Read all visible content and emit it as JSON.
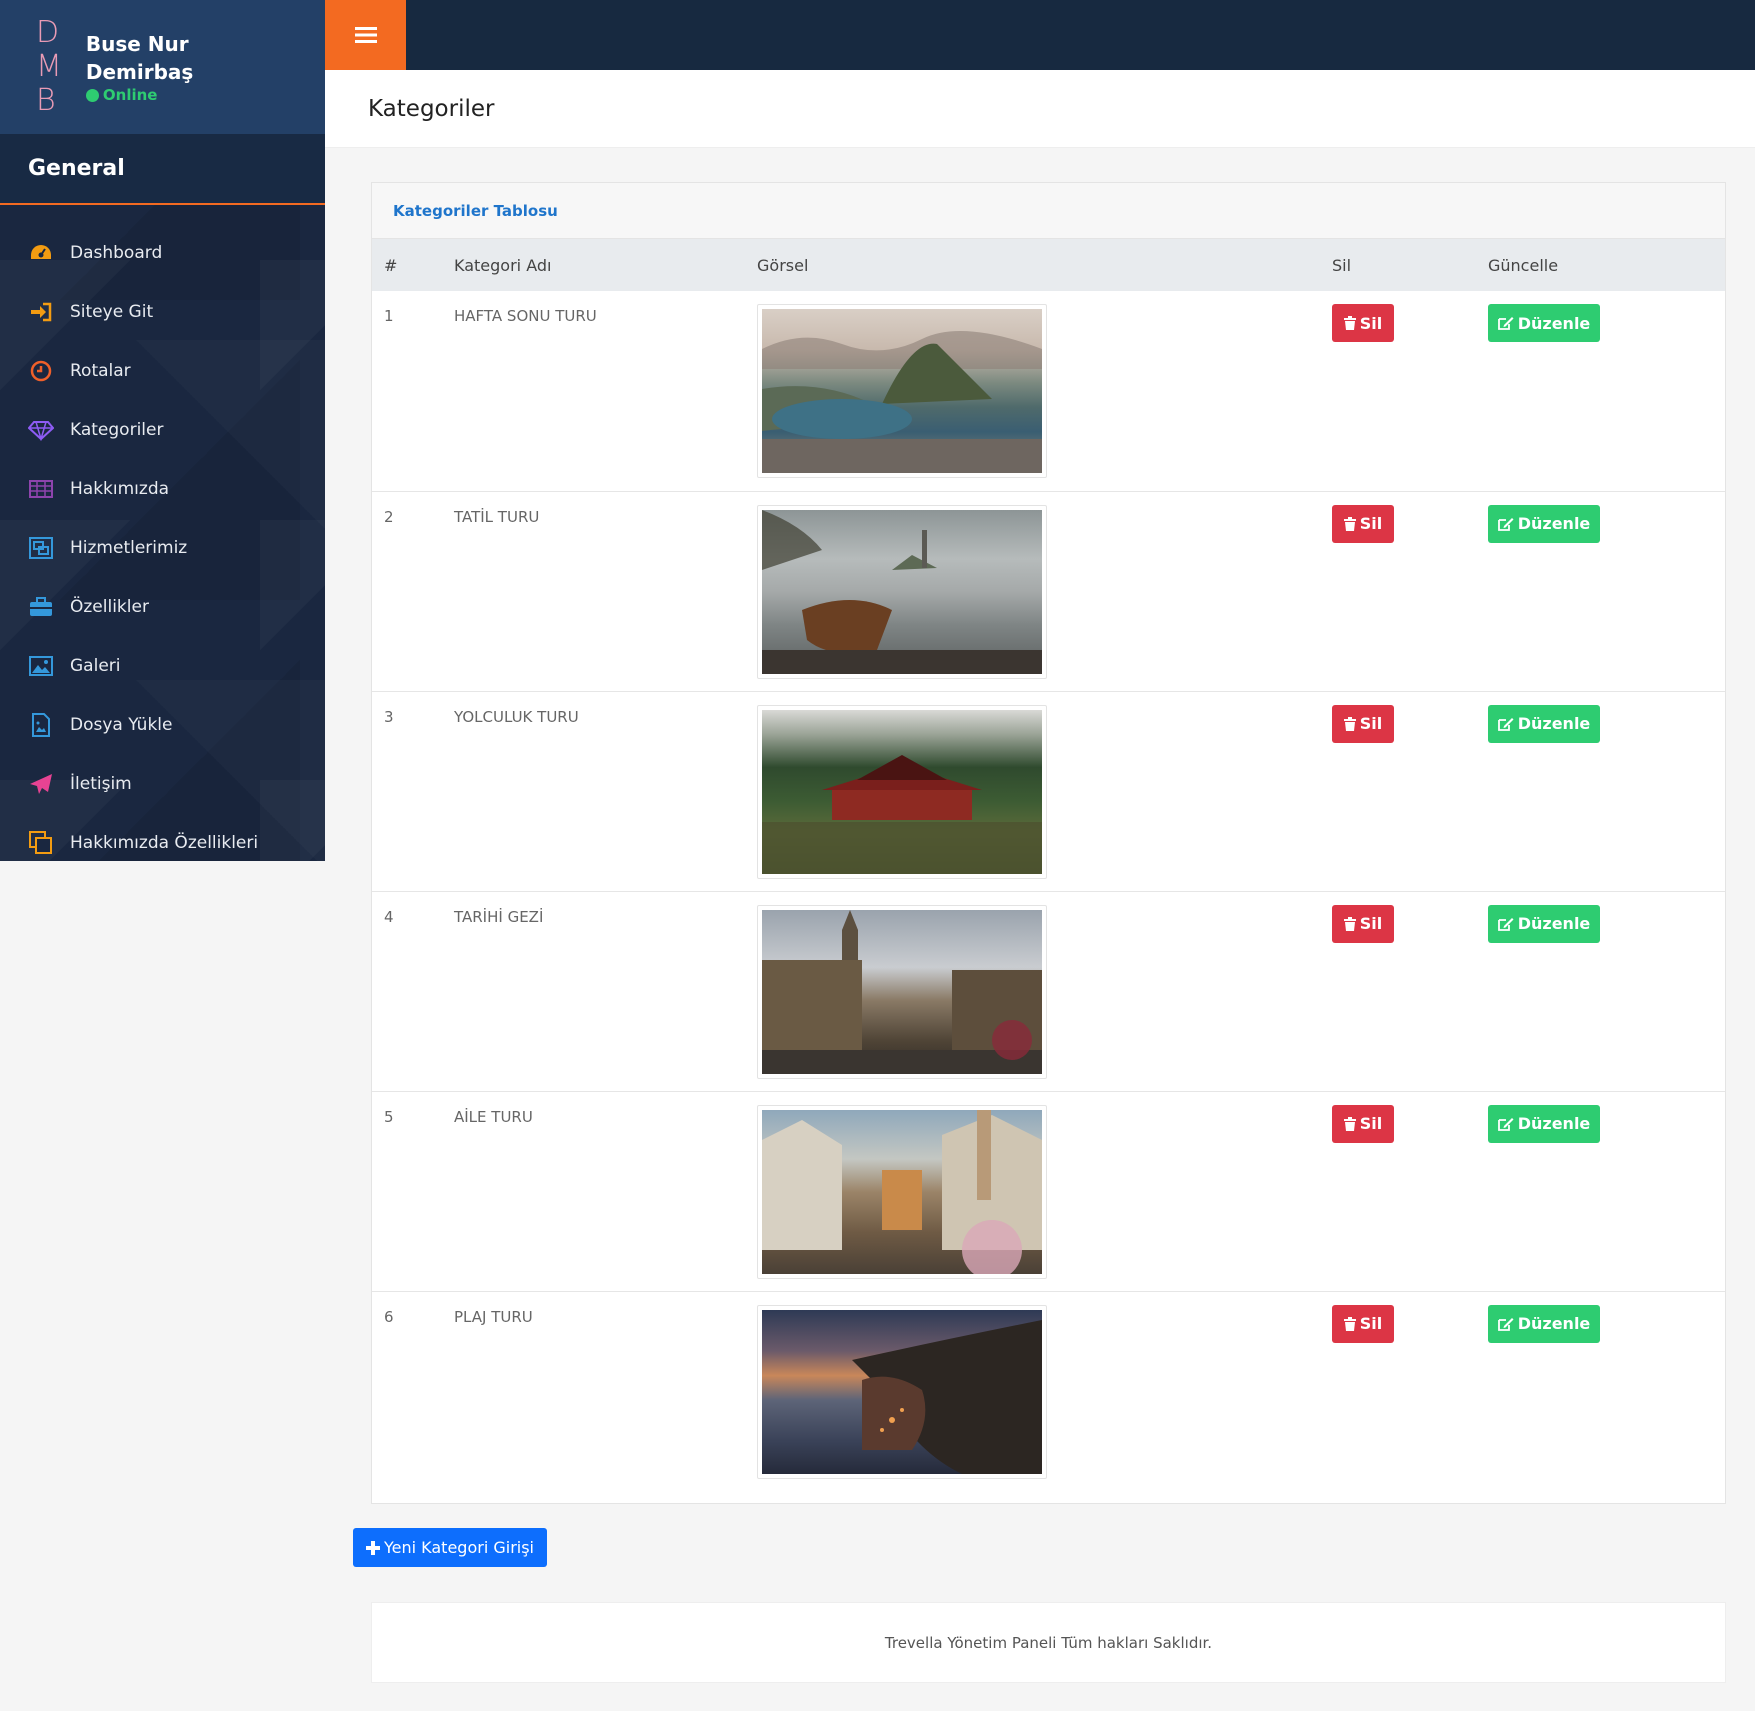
{
  "brand": {
    "letters": [
      "D",
      "M",
      "B"
    ],
    "user_name": "Buse Nur Demirbaş",
    "status": "Online"
  },
  "sidebar": {
    "section_title": "General",
    "items": [
      {
        "label": "Dashboard",
        "icon": "dashboard-icon",
        "color": "#f39c12"
      },
      {
        "label": "Siteye Git",
        "icon": "sign-in-icon",
        "color": "#f39c12"
      },
      {
        "label": "Rotalar",
        "icon": "clock-icon",
        "color": "#f0602a"
      },
      {
        "label": "Kategoriler",
        "icon": "diamond-icon",
        "color": "#8e5cf5"
      },
      {
        "label": "Hakkımızda",
        "icon": "table-icon",
        "color": "#8e44ad"
      },
      {
        "label": "Hizmetlerimiz",
        "icon": "object-group-icon",
        "color": "#3498db"
      },
      {
        "label": "Özellikler",
        "icon": "briefcase-icon",
        "color": "#3498db"
      },
      {
        "label": "Galeri",
        "icon": "image-icon",
        "color": "#3498db"
      },
      {
        "label": "Dosya Yükle",
        "icon": "file-image-icon",
        "color": "#3498db"
      },
      {
        "label": "İletişim",
        "icon": "paper-plane-icon",
        "color": "#e84393"
      },
      {
        "label": "Hakkımızda Özellikleri",
        "icon": "clone-icon",
        "color": "#f39c12"
      }
    ]
  },
  "header": {
    "page_title": "Kategoriler"
  },
  "card": {
    "title": "Kategoriler Tablosu",
    "columns": [
      "#",
      "Kategori Adı",
      "Görsel",
      "Sil",
      "Güncelle"
    ],
    "rows": [
      {
        "num": "1",
        "name": "HAFTA SONU TURU",
        "delete_label": "Sil",
        "edit_label": "Düzenle"
      },
      {
        "num": "2",
        "name": "TATİL TURU",
        "delete_label": "Sil",
        "edit_label": "Düzenle"
      },
      {
        "num": "3",
        "name": "YOLCULUK TURU",
        "delete_label": "Sil",
        "edit_label": "Düzenle"
      },
      {
        "num": "4",
        "name": "TARİHİ GEZİ",
        "delete_label": "Sil",
        "edit_label": "Düzenle"
      },
      {
        "num": "5",
        "name": "AİLE TURU",
        "delete_label": "Sil",
        "edit_label": "Düzenle"
      },
      {
        "num": "6",
        "name": "PLAJ TURU",
        "delete_label": "Sil",
        "edit_label": "Düzenle"
      }
    ]
  },
  "add_button_label": "Yeni Kategori Girişi",
  "footer_text": "Trevella Yönetim Paneli Tüm hakları Saklıdır.",
  "colors": {
    "accent": "#f36a21",
    "sidebar_bg": "#1a2740",
    "delete": "#dc3545",
    "edit": "#2ecc71",
    "primary": "#0d6efd",
    "link": "#1f75cb"
  }
}
